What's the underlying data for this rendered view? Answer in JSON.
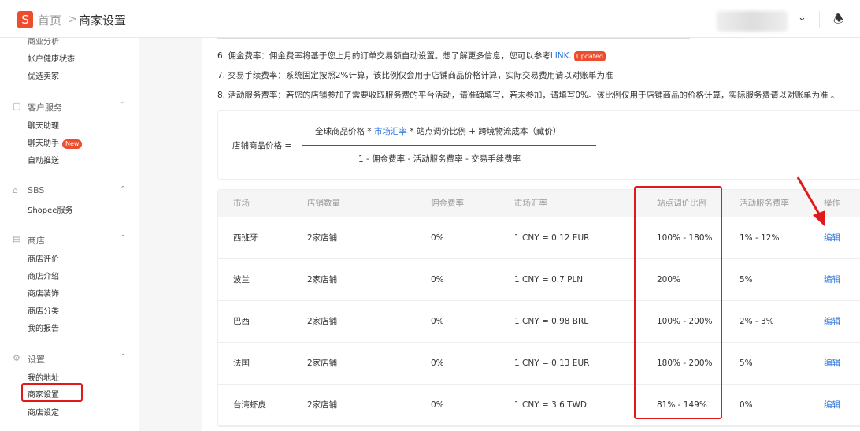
{
  "header": {
    "logo": "S",
    "breadcrumb": [
      "首页",
      "商家设置"
    ],
    "separator": ">",
    "icons": [
      "chevron-down-icon",
      "bell-icon"
    ]
  },
  "sidebar": {
    "partial_item": "商业分析",
    "items_top": [
      "帐户健康状态",
      "优选卖家"
    ],
    "groups": [
      {
        "title": "客户服务",
        "icon": "chat-icon",
        "items": [
          "聊天助理",
          "聊天助手",
          "自动推送"
        ],
        "badge": "New"
      },
      {
        "title": "SBS",
        "icon": "warehouse-icon",
        "items": [
          "Shopee服务"
        ]
      },
      {
        "title": "商店",
        "icon": "shop-icon",
        "items": [
          "商店评价",
          "商店介绍",
          "商店装饰",
          "商店分类",
          "我的报告"
        ]
      },
      {
        "title": "设置",
        "icon": "gear-icon",
        "items": [
          "我的地址",
          "商家设置",
          "商店设定"
        ]
      }
    ],
    "active": "商家设置"
  },
  "notes": {
    "n6_pre": "6. 佣金费率：佣金费率将基于您上月的订单交易额自动设置。想了解更多信息，您可以参考",
    "n6_link": "LINK",
    "n6_post": ".",
    "n6_badge": "Updated",
    "n7": "7. 交易手续费率：系统固定按照2%计算，该比例仅会用于店铺商品价格计算，实际交易费用请以对账单为准",
    "n8": "8. 活动服务费率：若您的店铺参加了需要收取服务费的平台活动，请准确填写，若未参加，请填写0%。该比例仅用于店铺商品的价格计算，实际服务费请以对账单为准 。"
  },
  "formula": {
    "label": "店铺商品价格 =",
    "num_a": "全球商品价格 * ",
    "num_link": "市场汇率",
    "num_b": " * 站点调价比例 + 跨境物流成本（藏价）",
    "den": "1 - 佣金费率 - 活动服务费率 - 交易手续费率"
  },
  "table": {
    "headers": [
      "市场",
      "店铺数量",
      "佣金费率",
      "市场汇率",
      "站点调价比例",
      "活动服务费率",
      "操作"
    ],
    "rows": [
      [
        "西班牙",
        "2家店铺",
        "0%",
        "1 CNY = 0.12 EUR",
        "100% - 180%",
        "1% - 12%",
        "编辑"
      ],
      [
        "波兰",
        "2家店铺",
        "0%",
        "1 CNY = 0.7 PLN",
        "200%",
        "5%",
        "编辑"
      ],
      [
        "巴西",
        "2家店铺",
        "0%",
        "1 CNY = 0.98 BRL",
        "100% - 200%",
        "2% - 3%",
        "编辑"
      ],
      [
        "法国",
        "2家店铺",
        "0%",
        "1 CNY = 0.13 EUR",
        "180% - 200%",
        "5%",
        "编辑"
      ],
      [
        "台湾虾皮",
        "2家店铺",
        "0%",
        "1 CNY = 3.6 TWD",
        "81% - 149%",
        "0%",
        "编辑"
      ]
    ]
  },
  "colors": {
    "brand": "#ee4d2d",
    "link": "#2673dd",
    "highlight": "#e01a1a"
  }
}
